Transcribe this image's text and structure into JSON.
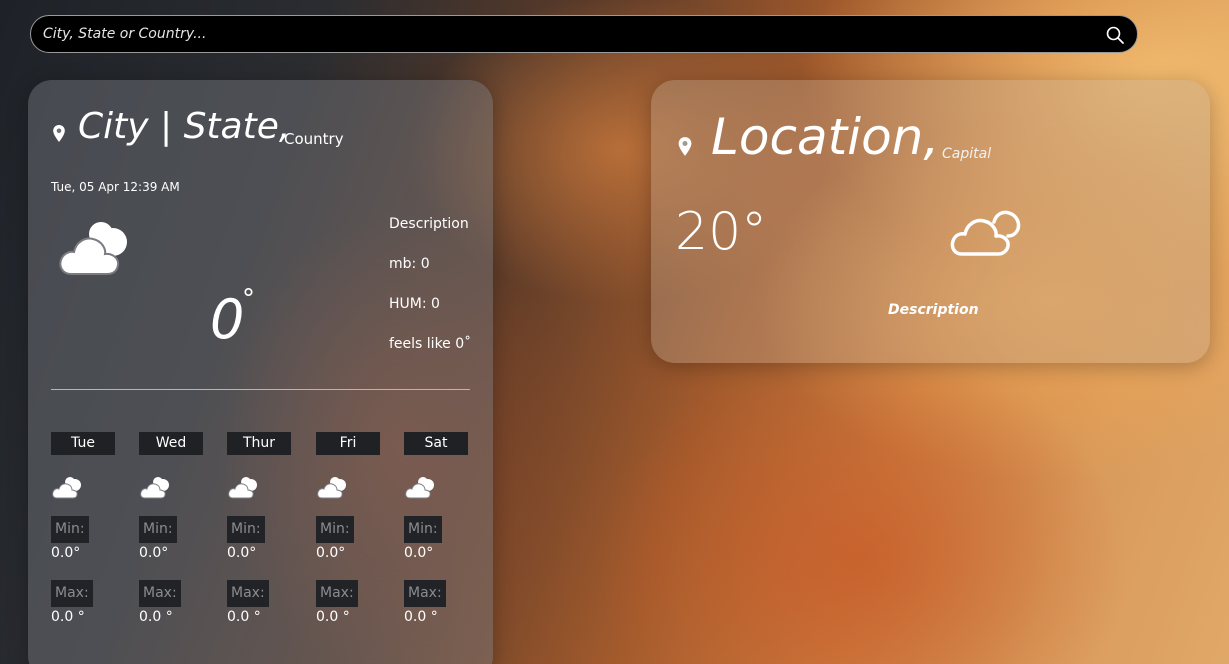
{
  "search": {
    "placeholder": "City, State or Country..."
  },
  "main_card": {
    "city_state": "City | State,",
    "country": "Country",
    "datetime": "Tue, 05 Apr 12:39 AM",
    "icon": "cloud-icon",
    "temperature": "0",
    "temperature_unit": "°",
    "description": "Description",
    "pressure": "mb: 0",
    "humidity": "HUM: 0",
    "feels_like": "feels like 0˚"
  },
  "forecast": [
    {
      "day": "Tue",
      "icon": "cloud-icon",
      "min_label": "Min:",
      "min": "0.0°",
      "max_label": "Max:",
      "max": "0.0 °"
    },
    {
      "day": "Wed",
      "icon": "cloud-icon",
      "min_label": "Min:",
      "min": "0.0°",
      "max_label": "Max:",
      "max": "0.0 °"
    },
    {
      "day": "Thur",
      "icon": "cloud-icon",
      "min_label": "Min:",
      "min": "0.0°",
      "max_label": "Max:",
      "max": "0.0 °"
    },
    {
      "day": "Fri",
      "icon": "cloud-icon",
      "min_label": "Min:",
      "min": "0.0°",
      "max_label": "Max:",
      "max": "0.0 °"
    },
    {
      "day": "Sat",
      "icon": "cloud-icon",
      "min_label": "Min:",
      "min": "0.0°",
      "max_label": "Max:",
      "max": "0.0 °"
    }
  ],
  "side_card": {
    "location": "Location,",
    "capital": "Capital",
    "temperature": "20°",
    "icon": "cloud-outline-icon",
    "description": "Description"
  },
  "colors": {
    "card_bg": "#8a8c92",
    "label_bg": "#202124",
    "search_bg": "#000000"
  }
}
